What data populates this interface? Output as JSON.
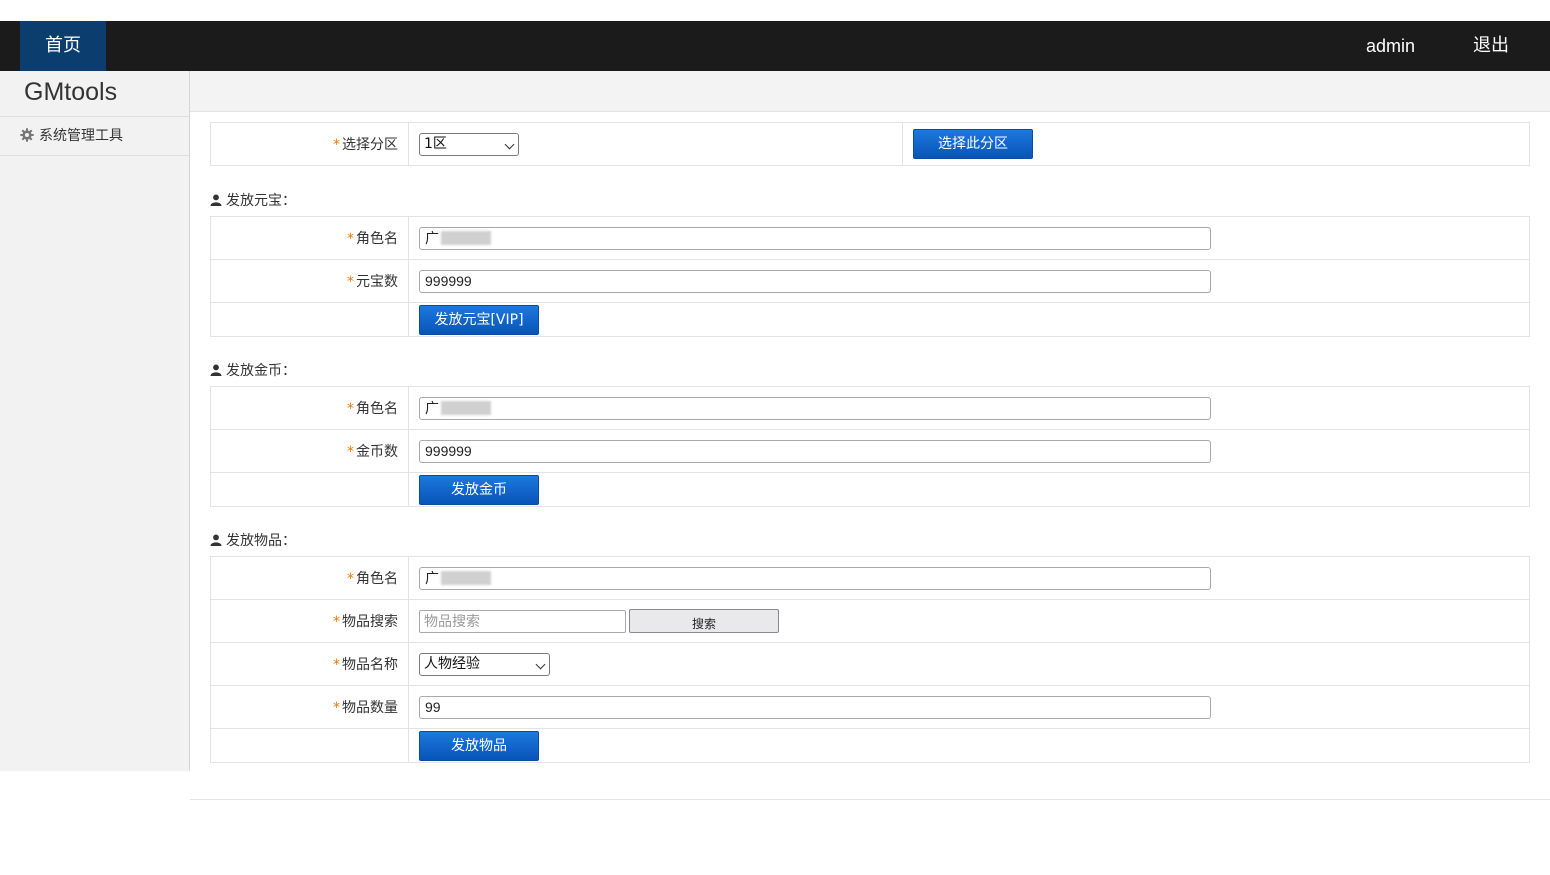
{
  "header": {
    "home_label": "首页",
    "user_label": "admin",
    "logout_label": "退出"
  },
  "sidebar": {
    "brand": "GMtools",
    "items": [
      {
        "label": "系统管理工具",
        "icon": "gear-icon"
      }
    ]
  },
  "zone": {
    "label": "选择分区",
    "selected": "1区",
    "button_label": "选择此分区"
  },
  "yuanbao": {
    "title": "发放元宝：",
    "role_label": "角色名",
    "role_value": "广",
    "amount_label": "元宝数",
    "amount_value": "999999",
    "button_label": "发放元宝[VIP]"
  },
  "gold": {
    "title": "发放金币：",
    "role_label": "角色名",
    "role_value": "广",
    "amount_label": "金币数",
    "amount_value": "999999",
    "button_label": "发放金币"
  },
  "items": {
    "title": "发放物品：",
    "role_label": "角色名",
    "role_value": "广",
    "search_label": "物品搜索",
    "search_placeholder": "物品搜索",
    "search_button": "搜索",
    "name_label": "物品名称",
    "name_selected": "人物经验",
    "quantity_label": "物品数量",
    "quantity_value": "99",
    "button_label": "发放物品"
  },
  "colors": {
    "topbar": "#1b1b1b",
    "nav_active": "#0b3d6e",
    "button": "#0a5fc8",
    "required_star": "#e87b00"
  }
}
